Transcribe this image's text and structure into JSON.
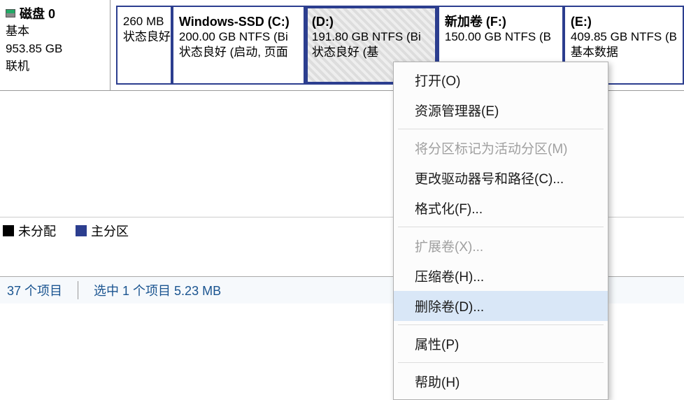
{
  "disk": {
    "title": "磁盘 0",
    "type": "基本",
    "size": "953.85 GB",
    "status": "联机"
  },
  "partitions": [
    {
      "title": "",
      "size": "260 MB",
      "status": "状态良好"
    },
    {
      "title": "Windows-SSD  (C:)",
      "size": "200.00 GB NTFS (Bi",
      "status": "状态良好 (启动, 页面"
    },
    {
      "title": "(D:)",
      "size": "191.80 GB NTFS (Bi",
      "status": "状态良好 (基"
    },
    {
      "title": "新加卷  (F:)",
      "size": "150.00 GB NTFS (B",
      "status": ""
    },
    {
      "title": "(E:)",
      "size": "409.85 GB NTFS (B",
      "status": "基本数据"
    }
  ],
  "legend": {
    "unallocated": "未分配",
    "primary": "主分区"
  },
  "explorer": {
    "count": "37 个项目",
    "selected": "选中 1 个项目  5.23 MB"
  },
  "menu": {
    "open": "打开(O)",
    "explorer": "资源管理器(E)",
    "mark_active": "将分区标记为活动分区(M)",
    "change_drive": "更改驱动器号和路径(C)...",
    "format": "格式化(F)...",
    "extend": "扩展卷(X)...",
    "shrink": "压缩卷(H)...",
    "delete": "删除卷(D)...",
    "properties": "属性(P)",
    "help": "帮助(H)"
  }
}
